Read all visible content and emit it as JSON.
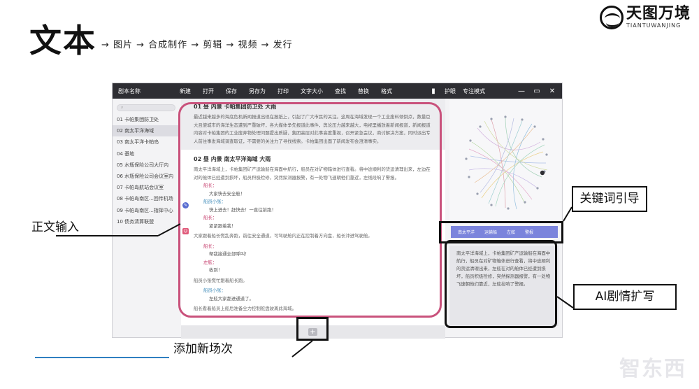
{
  "slide": {
    "title": "文本",
    "pipeline": "→ 图片 → 合成制作 → 剪辑 → 视频 → 发行",
    "brand_cn": "天图万境",
    "brand_en": "TIANTUWANJING",
    "watermark": "智东西"
  },
  "app": {
    "name": "剧本名称",
    "menu": [
      "新建",
      "打开",
      "保存",
      "另存为",
      "打印",
      "文字大小",
      "查找",
      "替换",
      "格式"
    ],
    "right_menu": [
      "护眼",
      "专注模式"
    ],
    "search_placeholder": "",
    "scenes": [
      "01 卡帕集团防卫处",
      "02 南太平洋海域",
      "03 南太平洋卡帕岛",
      "04 基地",
      "05 水瓶保险公司大厅内",
      "06 水瓶保险公司会议室内",
      "07 卡帕岛航站会议室",
      "08 卡帕岛南区...回传机场",
      "09 卡帕岛南区...指挥中心",
      "10 债务清算联盟"
    ],
    "scene1": {
      "heading": "01  昼  内景  卡帕集团防卫处  大雨",
      "text": "最近越来越多的海底危机新闻报道出现在报纸上，引起了广大市民的关注。这周在海域发现一个工业废料倾倒点，数量巨大且使城市的海洋生态遭到严重破坏，各大媒体争先报道此事件，舆论压力越来越大，电视里播放着新闻报道，新闻报道内容对卡帕集团的工业废弃物处理问题提出质疑，集团高层对此事高度重视，召开紧急会议，商讨解决方案，同时派出专人前往事发海域调查取证，不需要的关注力了寻找线索。卡帕集团出面了新闻发布会澄清事实。"
    },
    "scene2": {
      "heading": "02  昼  内景  南太平洋海域  大雨",
      "intro": "南太平洋海域上，卡帕集团矿产运输船在海面中航行，船员在对矿物箱体进行查看。将中途顺利的货运清理出来，左边在对的舱体已经遭到损坏，船员积极检修，突然探测器报警，有一处物飞速朝他们靠近，左线段响了警报。",
      "dialogue": [
        {
          "speaker": "船长：",
          "speaker_color": "pink",
          "line": "大家快去安全舱！"
        },
        {
          "speaker": "船员小张：",
          "speaker_color": "blue",
          "line": "快上进去！赶快去！一直往前跑！"
        },
        {
          "speaker": "船长：",
          "speaker_color": "pink",
          "line": "紧紧跟着我！"
        }
      ],
      "action1": "大家跟着船长慌乱奔跑，前往安全通道，可驾驶舱内正在控制着方向盘，船长沖进驾驶舱。",
      "dialogue2": [
        {
          "speaker": "船长：",
          "speaker_color": "pink",
          "line": "帮我接通全部呼叫！"
        },
        {
          "speaker": "左舷：",
          "speaker_color": "pink",
          "line": "收到！"
        }
      ],
      "action2": "船员小张慌忙跟着船长跑。",
      "dialogue3": [
        {
          "speaker": "船员小张：",
          "speaker_color": "blue",
          "line": "左舷大家都进通道了。"
        }
      ],
      "action3": "船长看着船员上船后准备全力控制舵盘驶离此海域。"
    },
    "keywords": [
      "南太平洋",
      "运输船",
      "左舷",
      "警报"
    ],
    "ai_text": "南太平洋海域上，卡帕集团矿产运输船在海面中航行，船员在对矿物箱体进行查看，将中途顺利的货运清理出来，左舷在对的舱体已经遭到损坏，船员积极检修，突然探测器报警，有一处物飞速朝他们靠近，左舷拉响了警报。"
  },
  "annotations": {
    "body_input": "正文输入",
    "keyword_guide": "关键词引导",
    "ai_expand": "AI剧情扩写",
    "add_scene": "添加新场次"
  },
  "colors": {
    "titlebar": "#2e2e33",
    "keyword_bar": "#7b84dc",
    "highlight_pink": "#c9527c",
    "speaker_pink": "#c43a6a",
    "speaker_blue": "#3d8ab8"
  }
}
